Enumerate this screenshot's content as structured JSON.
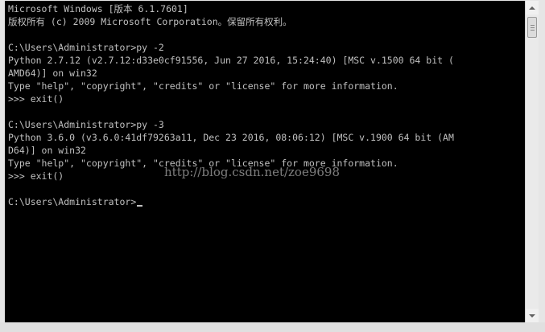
{
  "console": {
    "lines": [
      "Microsoft Windows [版本 6.1.7601]",
      "版权所有 (c) 2009 Microsoft Corporation。保留所有权利。",
      "",
      "C:\\Users\\Administrator>py -2",
      "Python 2.7.12 (v2.7.12:d33e0cf91556, Jun 27 2016, 15:24:40) [MSC v.1500 64 bit (",
      "AMD64)] on win32",
      "Type \"help\", \"copyright\", \"credits\" or \"license\" for more information.",
      ">>> exit()",
      "",
      "C:\\Users\\Administrator>py -3",
      "Python 3.6.0 (v3.6.0:41df79263a11, Dec 23 2016, 08:06:12) [MSC v.1900 64 bit (AM",
      "D64)] on win32",
      "Type \"help\", \"copyright\", \"credits\" or \"license\" for more information.",
      ">>> exit()",
      "",
      "C:\\Users\\Administrator>"
    ]
  },
  "watermark": "http://blog.csdn.net/zoe9698",
  "colors": {
    "background": "#000000",
    "text": "#c0c0c0",
    "scrollbar": "#eaeaea"
  }
}
